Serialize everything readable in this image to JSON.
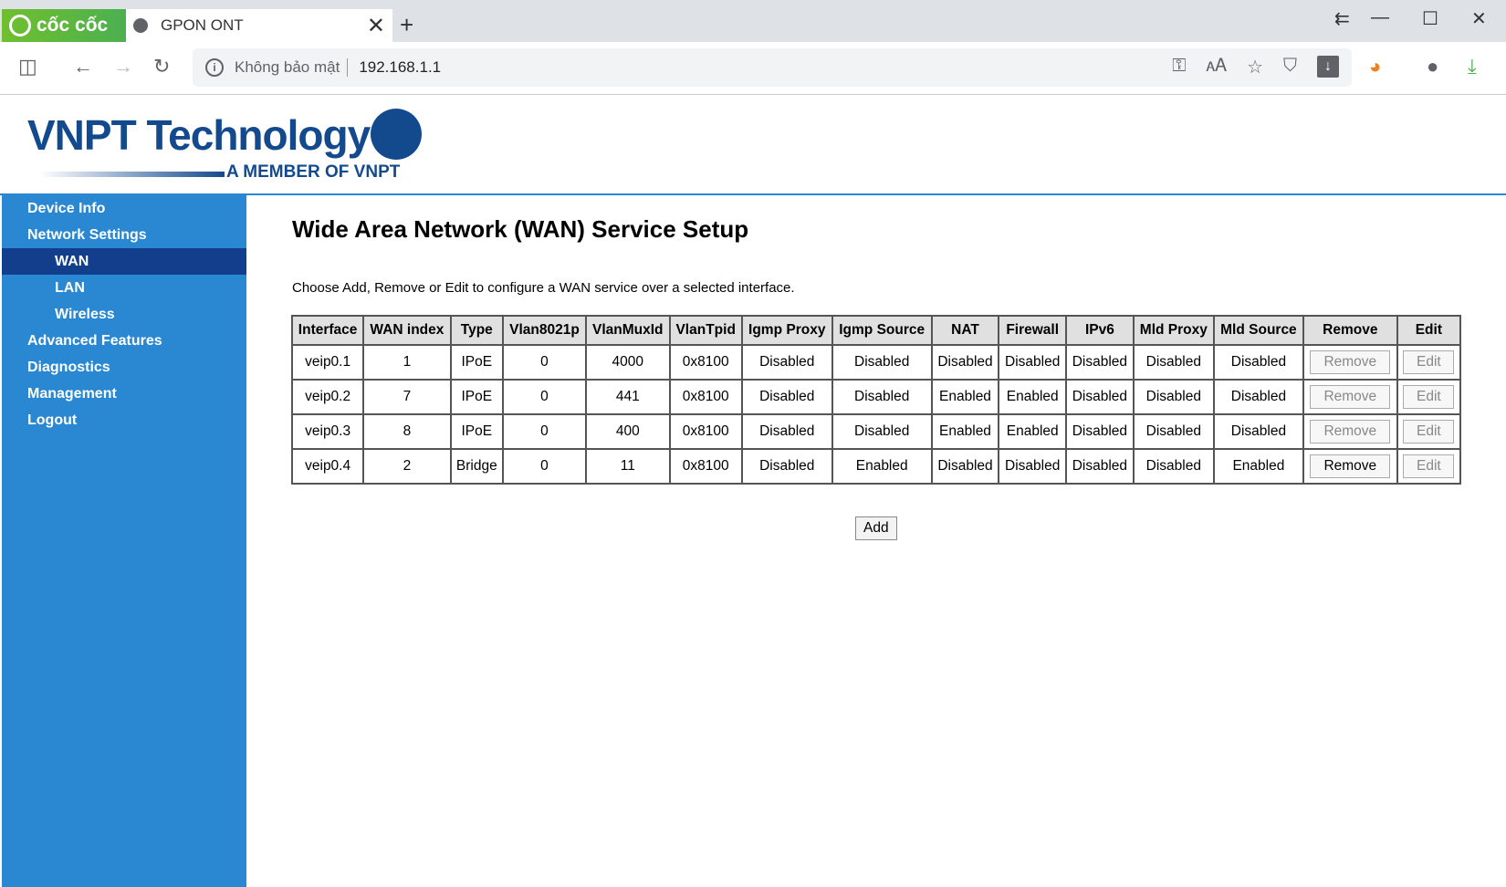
{
  "browser": {
    "brand": "cốc cốc",
    "tab_title": "GPON ONT",
    "security": "Không bảo mật",
    "url": "192.168.1.1"
  },
  "logo": {
    "name": "VNPT Technology",
    "tagline": "A MEMBER OF VNPT"
  },
  "sidebar": {
    "items": [
      {
        "label": "Device Info",
        "level": 0
      },
      {
        "label": "Network Settings",
        "level": 0
      },
      {
        "label": "WAN",
        "level": 1,
        "active": true
      },
      {
        "label": "LAN",
        "level": 1
      },
      {
        "label": "Wireless",
        "level": 1
      },
      {
        "label": "Advanced Features",
        "level": 0
      },
      {
        "label": "Diagnostics",
        "level": 0
      },
      {
        "label": "Management",
        "level": 0
      },
      {
        "label": "Logout",
        "level": 0
      }
    ]
  },
  "main": {
    "title": "Wide Area Network (WAN) Service Setup",
    "description": "Choose Add, Remove or Edit to configure a WAN service over a selected interface.",
    "add_label": "Add"
  },
  "table": {
    "headers": [
      "Interface",
      "WAN index",
      "Type",
      "Vlan8021p",
      "VlanMuxId",
      "VlanTpid",
      "Igmp Proxy",
      "Igmp Source",
      "NAT",
      "Firewall",
      "IPv6",
      "Mld Proxy",
      "Mld Source",
      "Remove",
      "Edit"
    ],
    "rows": [
      [
        "veip0.1",
        "1",
        "IPoE",
        "0",
        "4000",
        "0x8100",
        "Disabled",
        "Disabled",
        "Disabled",
        "Disabled",
        "Disabled",
        "Disabled",
        "Disabled"
      ],
      [
        "veip0.2",
        "7",
        "IPoE",
        "0",
        "441",
        "0x8100",
        "Disabled",
        "Disabled",
        "Enabled",
        "Enabled",
        "Disabled",
        "Disabled",
        "Disabled"
      ],
      [
        "veip0.3",
        "8",
        "IPoE",
        "0",
        "400",
        "0x8100",
        "Disabled",
        "Disabled",
        "Enabled",
        "Enabled",
        "Disabled",
        "Disabled",
        "Disabled"
      ],
      [
        "veip0.4",
        "2",
        "Bridge",
        "0",
        "11",
        "0x8100",
        "Disabled",
        "Enabled",
        "Disabled",
        "Disabled",
        "Disabled",
        "Disabled",
        "Enabled"
      ]
    ],
    "remove_label": "Remove",
    "edit_label": "Edit",
    "remove_enabled": [
      false,
      false,
      false,
      true
    ]
  }
}
